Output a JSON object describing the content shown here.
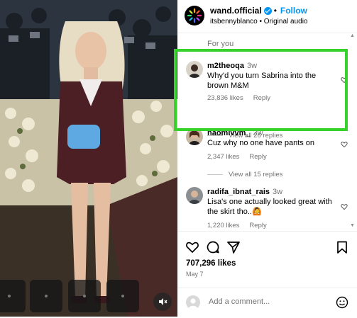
{
  "post": {
    "account": "wand.official",
    "follow_label": "Follow",
    "separator": "•",
    "subline": "itsbennyblanco • Original audio"
  },
  "feed_label": "For you",
  "comments": [
    {
      "user": "m2theoqa",
      "time": "3w",
      "text": "Why'd you turn Sabrina into the brown M&M",
      "likes": "23,836 likes",
      "reply_label": "Reply",
      "view_replies": "View all 26 replies"
    },
    {
      "user": "naomivvm_",
      "time": "3w",
      "text": "Cuz why no one have pants on",
      "likes": "2,347 likes",
      "reply_label": "Reply",
      "view_replies": "View all 15 replies"
    },
    {
      "user": "radifa_ibnat_rais",
      "time": "3w",
      "text": "Lisa's one actually looked great with the skirt tho..🙆",
      "likes": "1,220 likes",
      "reply_label": "Reply"
    }
  ],
  "actions": {
    "likes_count": "707,296 likes",
    "date": "May 7"
  },
  "comment_box": {
    "placeholder": "Add a comment..."
  },
  "icons": {
    "like": "heart-icon",
    "comment": "comment-icon",
    "share": "share-icon",
    "save": "bookmark-icon",
    "emoji": "emoji-icon",
    "mute": "speaker-muted-icon",
    "verified": "verified-badge-icon"
  },
  "colors": {
    "follow": "#0095f6",
    "highlight": "#36d12a",
    "muted_text": "#737373"
  }
}
